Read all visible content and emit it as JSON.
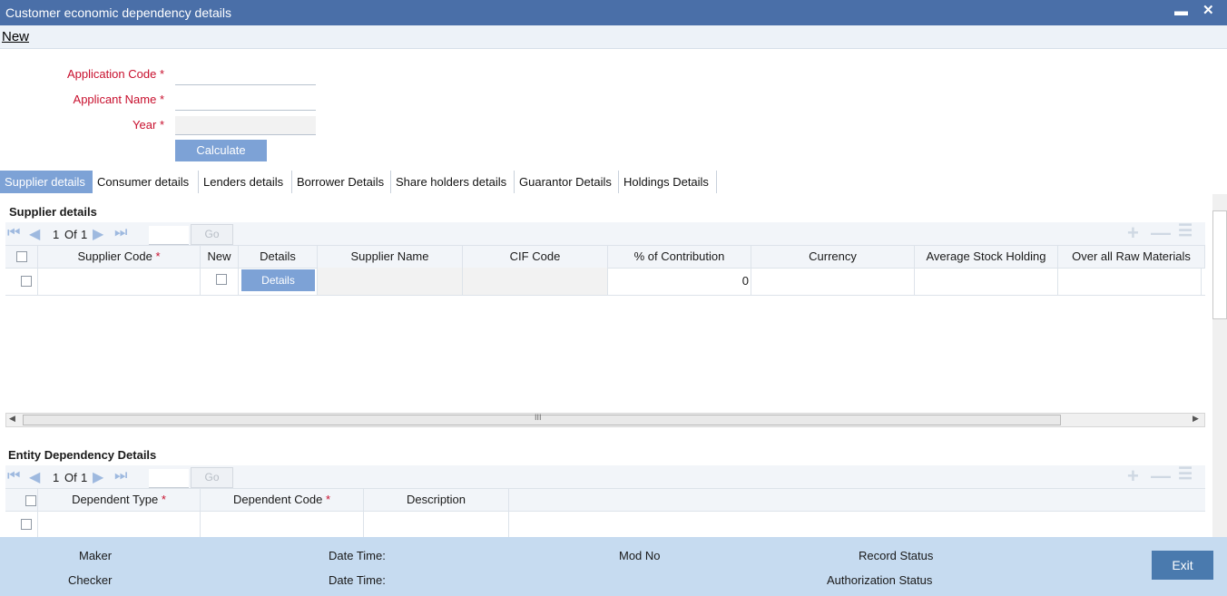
{
  "window": {
    "title": "Customer economic dependency details",
    "minimize": "▬",
    "close": "✕"
  },
  "menu": {
    "new_label": "New"
  },
  "form": {
    "application_code_label": "Application Code",
    "applicant_name_label": "Applicant Name",
    "year_label": "Year",
    "required": "*",
    "application_code_value": "",
    "applicant_name_value": "",
    "year_value": "",
    "calculate_label": "Calculate"
  },
  "tabs": [
    "Supplier details",
    "Consumer details",
    "Lenders details",
    "Borrower Details",
    "Share holders details",
    "Guarantor Details",
    "Holdings Details"
  ],
  "supplier": {
    "title": "Supplier details",
    "pager": {
      "current": "1",
      "of": "Of",
      "total": "1",
      "go": "Go"
    },
    "columns": [
      "Supplier Code",
      "New",
      "Details",
      "Supplier Name",
      "CIF Code",
      "% of Contribution",
      "Currency",
      "Average Stock Holding",
      "Over all Raw Materials"
    ],
    "row": {
      "details_button": "Details",
      "contribution": "0"
    },
    "scroll_grip": "III"
  },
  "entity": {
    "title": "Entity Dependency Details",
    "pager": {
      "current": "1",
      "of": "Of",
      "total": "1",
      "go": "Go"
    },
    "columns": [
      "Dependent Type",
      "Dependent Code",
      "Description"
    ]
  },
  "footer": {
    "maker": "Maker",
    "checker": "Checker",
    "date_time_1": "Date Time:",
    "date_time_2": "Date Time:",
    "mod_no": "Mod No",
    "record_status": "Record Status",
    "authorization_status": "Authorization Status",
    "exit": "Exit"
  },
  "icons": {
    "first": "first-page-icon",
    "prev": "prev-page-icon",
    "next": "next-page-icon",
    "last": "last-page-icon",
    "add": "add-row-icon",
    "remove": "remove-row-icon",
    "list": "list-view-icon"
  },
  "colors": {
    "titlebar": "#4a6fa8",
    "accent": "#7da2d6",
    "required": "#c8102e",
    "footer": "#c6dbf0"
  }
}
